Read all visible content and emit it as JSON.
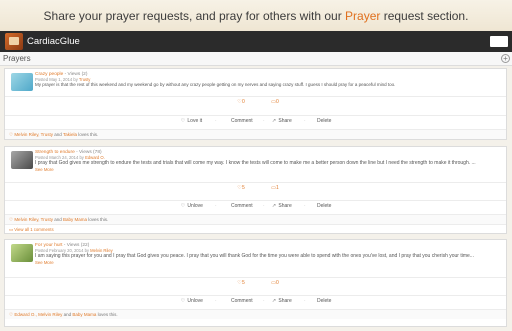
{
  "banner": {
    "text_before": "Share your prayer requests, and pray for others with our ",
    "accent": "Prayer",
    "text_after": " request section."
  },
  "app": {
    "title": "CardiacGlue"
  },
  "section": {
    "title": "Prayers",
    "add_icon": "plus-circle-icon"
  },
  "posts": [
    {
      "title": "Crazy people",
      "views": " - Views (2)",
      "meta_prefix": "Posted May 1, 2014 by ",
      "author": "Trusty",
      "body": "My prayer is that the rest of this weekend and my weekend go by without any crazy people getting on my nerves and saying crazy stuff. I guess I should pray for a peaceful mind too.",
      "see_more": "",
      "prayers_count": "0",
      "comments_count": "0",
      "love_label": "Love it",
      "comment_label": "Comment",
      "share_label": "Share",
      "delete_label": "Delete",
      "likes_names": "Melvin Riley, Trusty",
      "likes_and": " and ",
      "likes_last": "Takiela",
      "likes_suffix": " loves this.",
      "comments_link": ""
    },
    {
      "title": "Strength to endure",
      "views": " - Views (78)",
      "meta_prefix": "Posted March 24, 2014 by ",
      "author": "Edward O.",
      "body": "I pray that God gives me strength to endure the tests and trials that will come my way. I know the tests will come to make me a better person down the line but I need the strength to make it through. ...",
      "see_more": "See More",
      "prayers_count": "5",
      "comments_count": "1",
      "love_label": "Unlove",
      "comment_label": "Comment",
      "share_label": "Share",
      "delete_label": "Delete",
      "likes_names": "Melvin Riley, Trusty",
      "likes_and": " and ",
      "likes_last": "Baby Mama",
      "likes_suffix": " loves this.",
      "comments_link": "View all 1 comments"
    },
    {
      "title": "For your hurt",
      "views": " - Views (22)",
      "meta_prefix": "Posted February 20, 2014 by ",
      "author": "Melvin Riley",
      "body": "I am saying this prayer for you and I pray that God gives you peace. I pray that you will thank God for the time you were able to spend with the ones you've lost, and I pray that you cherish your time...",
      "see_more": "See More",
      "prayers_count": "5",
      "comments_count": "0",
      "love_label": "Unlove",
      "comment_label": "Comment",
      "share_label": "Share",
      "delete_label": "Delete",
      "likes_names": "Edward O., Melvin Riley",
      "likes_and": " and ",
      "likes_last": "Baby Mama",
      "likes_suffix": " loves this.",
      "comments_link": ""
    }
  ],
  "colors": {
    "accent": "#e07a2a",
    "appbar": "#2b2b2b"
  }
}
